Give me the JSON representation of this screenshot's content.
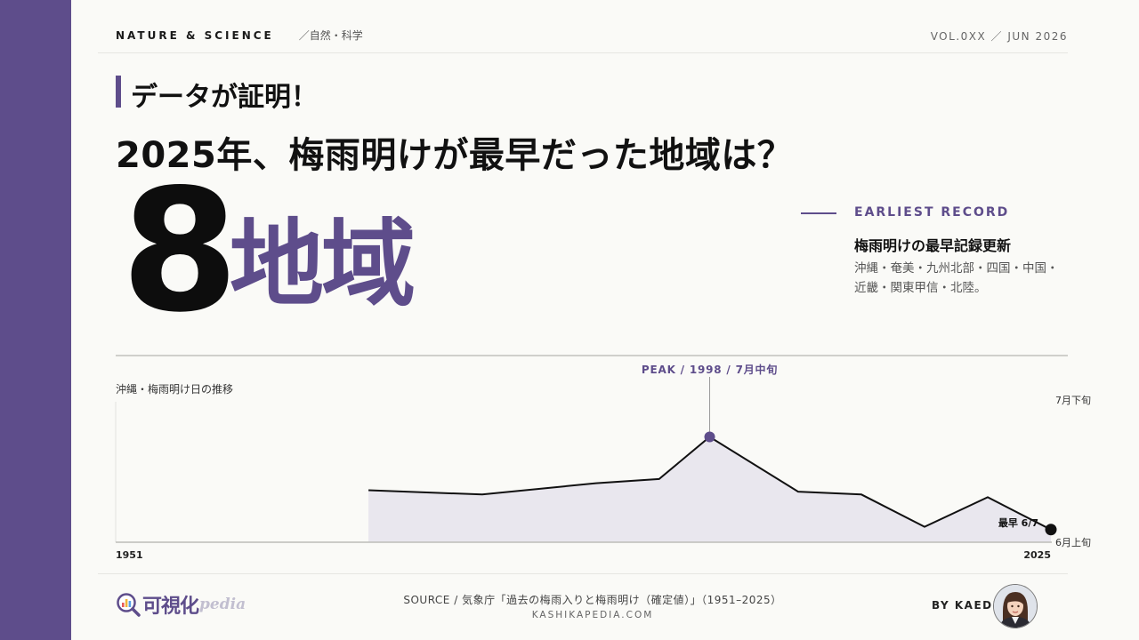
{
  "header": {
    "category": "NATURE & SCIENCE",
    "subcategory": "／自然・科学",
    "issue": "VOL.0XX ／ JUN 2026"
  },
  "kicker": "データが証明！",
  "headline": "2025年、梅雨明けが最早だった地域は？",
  "hero": {
    "number": "8",
    "unit": "地域"
  },
  "record": {
    "label": "EARLIEST RECORD",
    "title": "梅雨明けの最早記録更新",
    "text": "沖縄・奄美・九州北部・四国・中国・近畿・関東甲信・北陸。"
  },
  "chart_data": {
    "type": "area",
    "title": "沖縄・梅雨明け日の推移",
    "x_start_label": "1951",
    "x_end_label": "2025",
    "y_top_label": "7月下旬",
    "y_bottom_label": "6月上旬",
    "ylim": [
      "6月上旬",
      "7月下旬"
    ],
    "x": [
      1971,
      1980,
      1989,
      1994,
      1998,
      2005,
      2010,
      2015,
      2020,
      2025
    ],
    "values": [
      0.37,
      0.34,
      0.42,
      0.45,
      0.75,
      0.36,
      0.34,
      0.11,
      0.32,
      0.09
    ],
    "peak": {
      "x": 1998,
      "label": "PEAK / 1998 / 7月中旬"
    },
    "last": {
      "x": 2025,
      "label": "最早 6/7"
    },
    "colors": {
      "line": "#111111",
      "fill": "#e9e7ee",
      "accent": "#5e4d8b",
      "axis": "#bdbdb8"
    }
  },
  "footer": {
    "logo_word": "可視化",
    "logo_sub": "pedia",
    "source": "SOURCE / 気象庁「過去の梅雨入りと梅雨明け（確定値）」（1951–2025）",
    "site": "KASHIKAPEDIA.COM",
    "byline": "BY KAEDE"
  }
}
